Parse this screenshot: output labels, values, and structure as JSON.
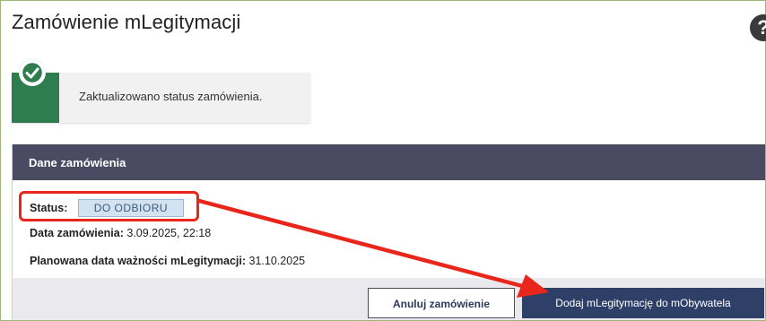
{
  "page": {
    "title": "Zamówienie mLegitymacji",
    "help_icon": "question-circle-icon",
    "help_glyph": "?"
  },
  "notification": {
    "icon": "check-circle-icon",
    "message": "Zaktualizowano status zamówienia.",
    "color": "#2e7d4f"
  },
  "order": {
    "header": "Dane zamówienia",
    "header_color": "#4a4a63",
    "status_label": "Status:",
    "status_value": "DO ODBIORU",
    "date_label": "Data zamówienia:",
    "date_value": "3.09.2025, 22:18",
    "expiry_label": "Planowana data ważności mLegitymacji:",
    "expiry_value": "31.10.2025"
  },
  "actions": {
    "cancel_label": "Anuluj zamówienie",
    "primary_label": "Dodaj mLegitymację do mObywatela",
    "primary_color": "#2e4068"
  },
  "annotation": {
    "color": "#e8261c",
    "shape": "highlight-box-with-arrow"
  }
}
